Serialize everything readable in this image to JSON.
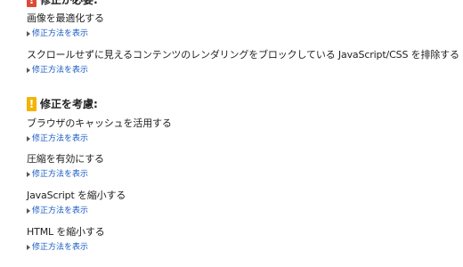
{
  "sections": [
    {
      "badge_text": "!",
      "badge_color": "#dd4b39",
      "title": "修正が必要:",
      "items": [
        {
          "title": "画像を最適化する",
          "link": "修正方法を表示"
        },
        {
          "title": "スクロールせずに見えるコンテンツのレンダリングをブロックしている JavaScript/CSS を排除する",
          "link": "修正方法を表示"
        }
      ]
    },
    {
      "badge_text": "!",
      "badge_color": "#f4b400",
      "title": "修正を考慮:",
      "items": [
        {
          "title": "ブラウザのキャッシュを活用する",
          "link": "修正方法を表示"
        },
        {
          "title": "圧縮を有効にする",
          "link": "修正方法を表示"
        },
        {
          "title": "JavaScript を縮小する",
          "link": "修正方法を表示"
        },
        {
          "title": "HTML を縮小する",
          "link": "修正方法を表示"
        }
      ]
    }
  ]
}
